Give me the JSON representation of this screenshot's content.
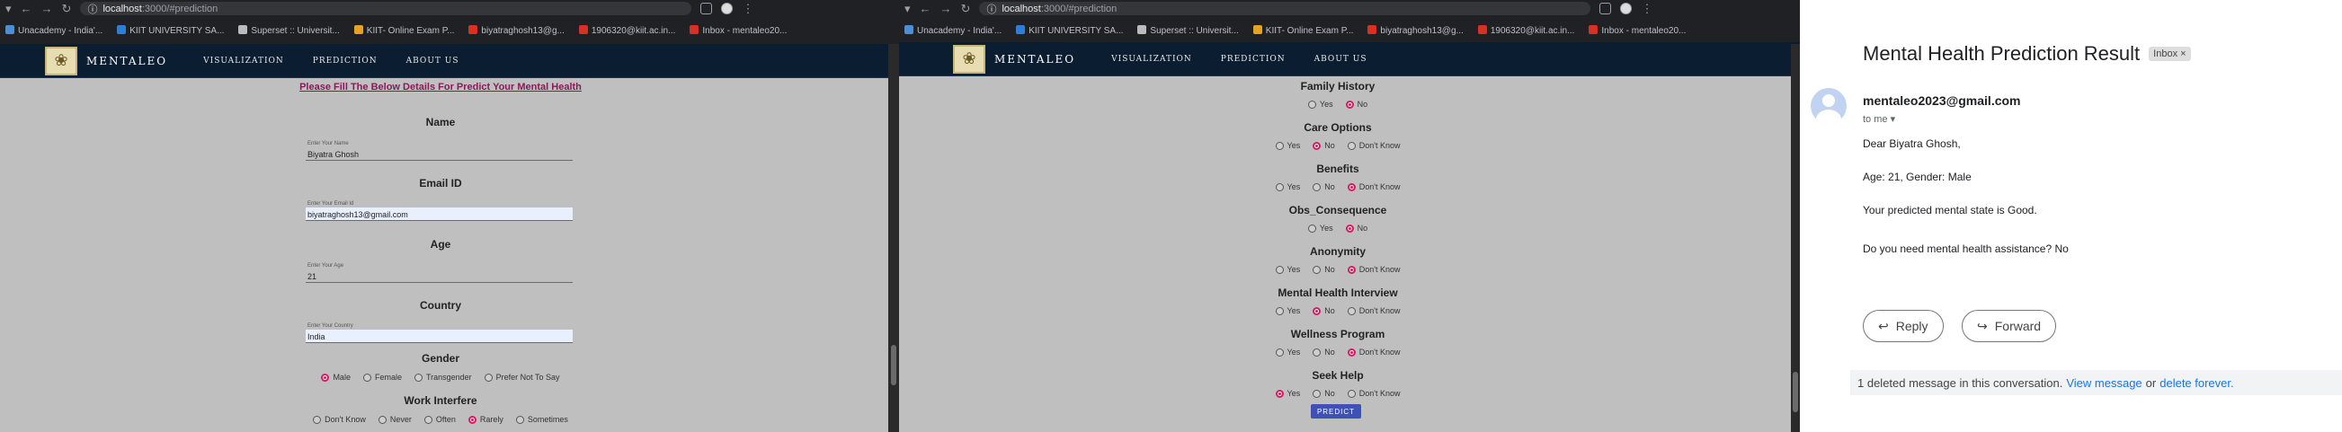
{
  "left_browser": {
    "url_host": "localhost",
    "url_path": ":3000/#prediction",
    "bookmarks": [
      "Unacademy - India'...",
      "KIIT UNIVERSITY SA...",
      "Superset :: Universit...",
      "KIIT- Online Exam P...",
      "biyatraghosh13@g...",
      "1906320@kiit.ac.in...",
      "Inbox - mentaleo20..."
    ]
  },
  "right_browser": {
    "url_host": "localhost",
    "url_path": ":3000/#prediction",
    "bookmarks": [
      "Unacademy - India'...",
      "KIIT UNIVERSITY SA...",
      "Superset :: Universit...",
      "KIIT- Online Exam P...",
      "biyatraghosh13@g...",
      "1906320@kiit.ac.in...",
      "Inbox - mentaleo20..."
    ]
  },
  "nav": {
    "brand": "MENTALEO",
    "links": [
      "VISUALIZATION",
      "PREDICTION",
      "ABOUT US"
    ]
  },
  "form": {
    "headline": "Please Fill The Below Details For Predict Your Mental Health",
    "name_label": "Name",
    "name_placeholder": "Enter Your Name",
    "name_value": "Biyatra Ghosh",
    "email_label": "Email ID",
    "email_placeholder": "Enter Your Email Id",
    "email_value": "biyatraghosh13@gmail.com",
    "age_label": "Age",
    "age_placeholder": "Enter Your Age",
    "age_value": "21",
    "country_label": "Country",
    "country_placeholder": "Enter Your Country",
    "country_value": "India",
    "gender_label": "Gender",
    "gender_options": [
      "Male",
      "Female",
      "Transgender",
      "Prefer Not To Say"
    ],
    "gender_selected": "Male",
    "work_label": "Work Interfere",
    "work_options": [
      "Don't Know",
      "Never",
      "Often",
      "Rarely",
      "Sometimes"
    ],
    "work_selected": "Rarely"
  },
  "questions": [
    {
      "label": "Family History",
      "options": [
        "Yes",
        "No"
      ],
      "selected": "No"
    },
    {
      "label": "Care Options",
      "options": [
        "Yes",
        "No",
        "Don't Know"
      ],
      "selected": "No"
    },
    {
      "label": "Benefits",
      "options": [
        "Yes",
        "No",
        "Don't Know"
      ],
      "selected": "Don't Know"
    },
    {
      "label": "Obs_Consequence",
      "options": [
        "Yes",
        "No"
      ],
      "selected": "No"
    },
    {
      "label": "Anonymity",
      "options": [
        "Yes",
        "No",
        "Don't Know"
      ],
      "selected": "Don't Know"
    },
    {
      "label": "Mental Health Interview",
      "options": [
        "Yes",
        "No",
        "Don't Know"
      ],
      "selected": "No"
    },
    {
      "label": "Wellness Program",
      "options": [
        "Yes",
        "No",
        "Don't Know"
      ],
      "selected": "Don't Know"
    },
    {
      "label": "Seek Help",
      "options": [
        "Yes",
        "No",
        "Don't Know"
      ],
      "selected": "Yes"
    }
  ],
  "predict_label": "PREDICT",
  "email": {
    "subject": "Mental Health Prediction Result",
    "tag": "Inbox",
    "tag_close": "×",
    "sender": "mentaleo2023@gmail.com",
    "to": "to me",
    "greeting": "Dear Biyatra Ghosh,",
    "line1": "Age: 21, Gender: Male",
    "line2": "Your predicted mental state is Good.",
    "line3": "Do you need mental health assistance? No",
    "reply": "Reply",
    "forward": "Forward",
    "deleted_text": "1 deleted message in this conversation.",
    "view_message": "View message",
    "or": "or",
    "delete_forever": "delete forever."
  },
  "colors": {
    "accent": "#d81b60",
    "nav_bg": "#0b1d31",
    "predict_btn": "#3f51b5",
    "headline": "#8a1a5c"
  }
}
